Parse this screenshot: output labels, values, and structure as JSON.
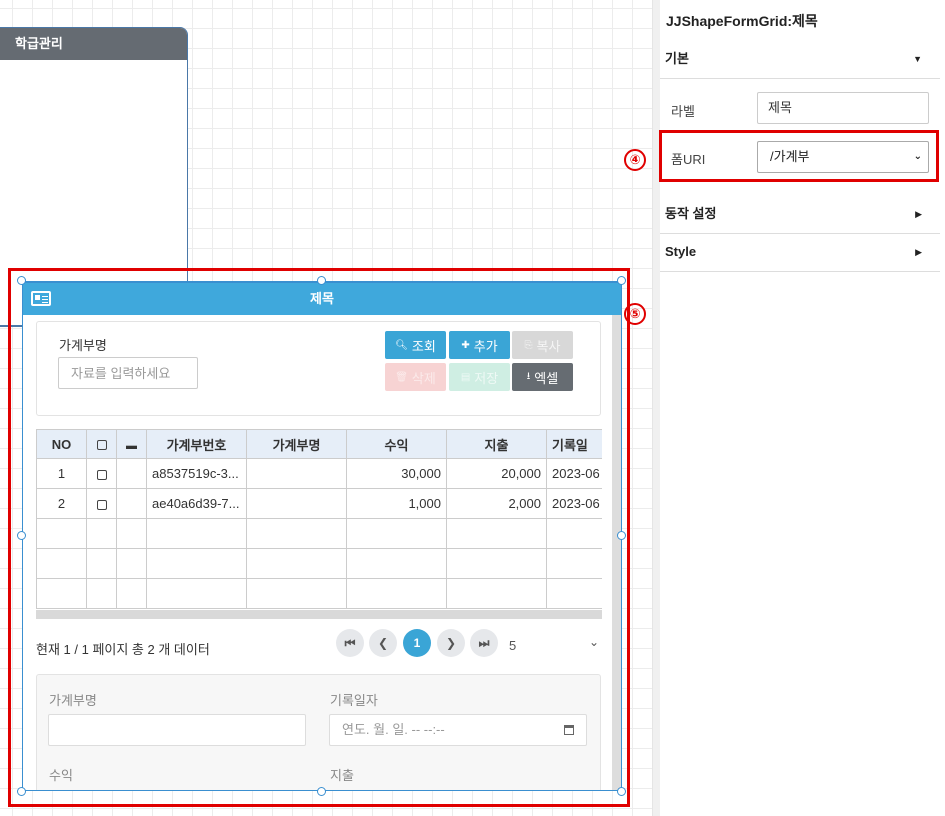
{
  "canvas": {
    "bg_shape_title": "학급관리"
  },
  "grid_shape": {
    "title": "제목",
    "search": {
      "label": "가계부명",
      "placeholder": "자료를 입력하세요"
    },
    "buttons": {
      "search": "조회",
      "add": "추가",
      "copy": "복사",
      "delete": "삭제",
      "save": "저장",
      "excel": "엑셀"
    },
    "columns": [
      "NO",
      "",
      "",
      "가계부번호",
      "가계부명",
      "수익",
      "지출",
      "기록일"
    ],
    "rows": [
      {
        "no": "1",
        "id": "a8537519c-3...",
        "name": "",
        "income": "30,000",
        "expense": "20,000",
        "date": "2023-06"
      },
      {
        "no": "2",
        "id": "ae40a6d39-7...",
        "name": "",
        "income": "1,000",
        "expense": "2,000",
        "date": "2023-06"
      }
    ],
    "pager": {
      "info": "현재 1 / 1 페이지 총 2 개 데이터",
      "current_page": "1",
      "page_size": "5"
    },
    "form": {
      "name_label": "가계부명",
      "date_label": "기록일자",
      "date_placeholder": "연도. 월. 일. -- --:--",
      "income_label": "수익",
      "expense_label": "지출"
    }
  },
  "markers": {
    "m4": "④",
    "m5": "⑤"
  },
  "panel": {
    "title": "JJShapeFormGrid:제목",
    "section_basic": "기본",
    "label_label": "라벨",
    "label_value": "제목",
    "form_uri_label": "폼URI",
    "form_uri_value": "/가계부",
    "section_action": "동작 설정",
    "section_style": "Style"
  },
  "colors": {
    "header_blue": "#3fa8dc",
    "highlight_red": "#e00000",
    "btn_blue": "#3aa5d6",
    "btn_dark": "#666c72"
  }
}
